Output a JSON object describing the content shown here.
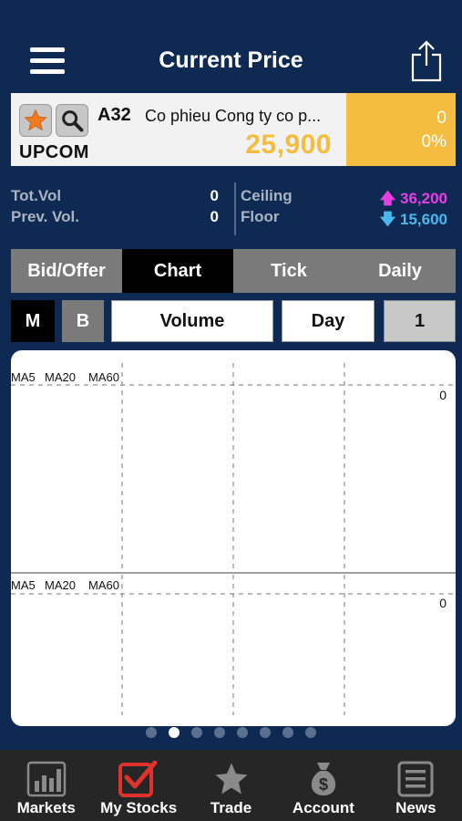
{
  "header": {
    "title": "Current Price"
  },
  "stock": {
    "symbol": "A32",
    "company": "Co phieu Cong ty co p...",
    "exchange": "UPCOM",
    "price": "25,900",
    "change": "0",
    "change_pct": "0%"
  },
  "stats": {
    "tot_vol_label": "Tot.Vol",
    "tot_vol": "0",
    "prev_vol_label": "Prev. Vol.",
    "prev_vol": "0",
    "ceiling_label": "Ceiling",
    "ceiling": "36,200",
    "floor_label": "Floor",
    "floor": "15,600",
    "ceiling_color": "#e93ee6",
    "floor_color": "#4ab8ef"
  },
  "tabs": [
    {
      "label": "Bid/Offer",
      "active": false
    },
    {
      "label": "Chart",
      "active": true
    },
    {
      "label": "Tick",
      "active": false
    },
    {
      "label": "Daily",
      "active": false
    }
  ],
  "controls": {
    "m_label": "M",
    "b_label": "B",
    "indicator": "Volume",
    "period": "Day",
    "interval": "1"
  },
  "chart": {
    "top_ma_labels": [
      "MA5",
      "MA20",
      "MA60"
    ],
    "top_axis_value": "0",
    "bottom_ma_labels": [
      "MA5",
      "MA20",
      "MA60"
    ],
    "bottom_axis_value": "0"
  },
  "pager": {
    "count": 8,
    "active_index": 1
  },
  "tabbar": [
    {
      "label": "Markets",
      "icon": "bar-chart-icon"
    },
    {
      "label": "My Stocks",
      "icon": "checkbox-icon"
    },
    {
      "label": "Trade",
      "icon": "star-icon"
    },
    {
      "label": "Account",
      "icon": "money-bag-icon"
    },
    {
      "label": "News",
      "icon": "newspaper-icon"
    }
  ],
  "colors": {
    "background": "#0f2a52",
    "accent": "#f4bd3f",
    "tabbar_active": "#e0322c"
  }
}
